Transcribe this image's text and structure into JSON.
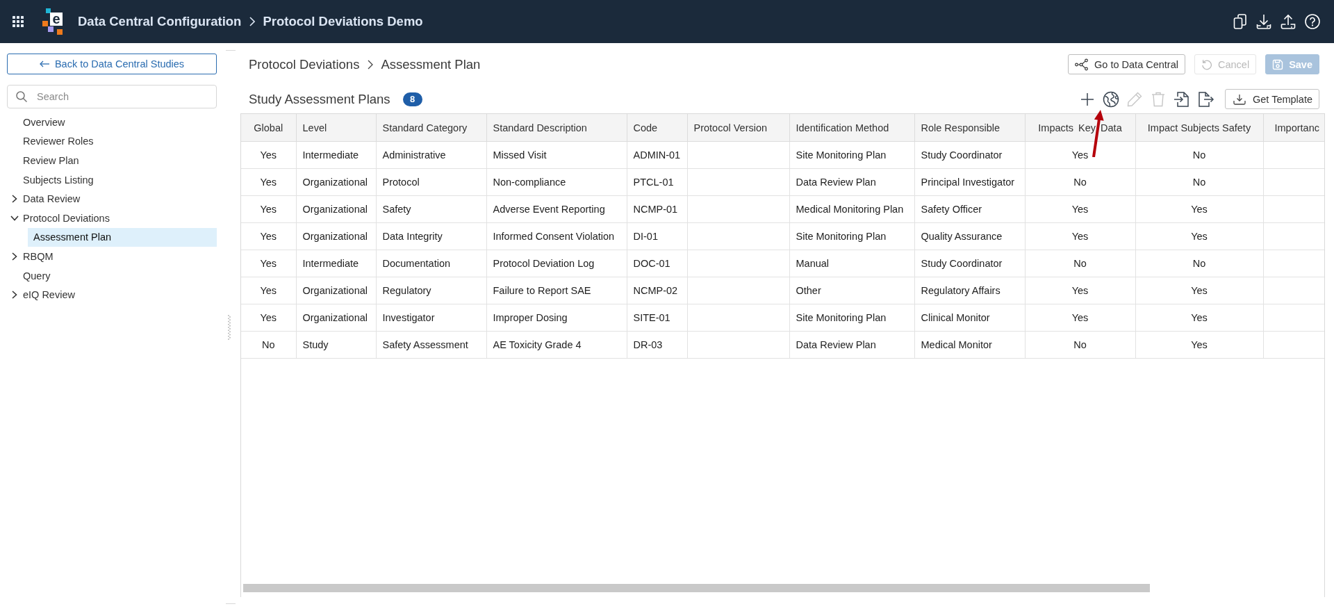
{
  "topbar": {
    "logo_letter": "e",
    "breadcrumb": [
      "Data Central Configuration",
      "Protocol Deviations Demo"
    ]
  },
  "sidebar": {
    "back_button": "Back to Data Central Studies",
    "search": {
      "placeholder": "Search"
    },
    "items": [
      {
        "label": "Overview",
        "kind": "page",
        "selected": false
      },
      {
        "label": "Reviewer Roles",
        "kind": "page",
        "selected": false
      },
      {
        "label": "Review Plan",
        "kind": "page",
        "selected": false
      },
      {
        "label": "Subjects Listing",
        "kind": "page",
        "selected": false
      },
      {
        "label": "Data Review",
        "kind": "folder",
        "expanded": false,
        "selected": false
      },
      {
        "label": "Protocol Deviations",
        "kind": "folder",
        "expanded": true,
        "selected": false,
        "children": [
          {
            "label": "Assessment Plan",
            "kind": "page",
            "selected": true
          }
        ]
      },
      {
        "label": "RBQM",
        "kind": "folder",
        "expanded": false,
        "selected": false
      },
      {
        "label": "Query",
        "kind": "page",
        "selected": false
      },
      {
        "label": "eIQ Review",
        "kind": "folder",
        "expanded": false,
        "selected": false
      }
    ]
  },
  "page": {
    "breadcrumb": [
      "Protocol Deviations",
      "Assessment Plan"
    ],
    "actions": [
      {
        "label": "Go to Data Central",
        "kind": "outline",
        "disabled": false
      },
      {
        "label": "Cancel",
        "kind": "outline",
        "disabled": true
      },
      {
        "label": "Save",
        "kind": "primary",
        "disabled": true
      }
    ]
  },
  "section": {
    "title": "Study Assessment Plans",
    "count": "8",
    "tools": [
      {
        "disabled": false
      },
      {
        "disabled": false
      },
      {
        "disabled": true
      },
      {
        "disabled": true
      },
      {
        "disabled": false
      },
      {
        "disabled": false
      }
    ],
    "template_button": "Get Template"
  },
  "table": {
    "columns": [
      "Global",
      "Level",
      "Standard Category",
      "Standard Description",
      "Code",
      "Protocol Version",
      "Identification Method",
      "Role Responsible",
      "Impacts Key Data",
      "Impact Subjects Safety",
      "Importanc"
    ],
    "rows": [
      {
        "global": "Yes",
        "level": "Intermediate",
        "standard_category": "Administrative",
        "standard_description": "Missed Visit",
        "code": "ADMIN-01",
        "identification_method": "Site Monitoring Plan",
        "role_responsible": "Study Coordinator",
        "impacts_key_data": "Yes",
        "impact_subjects_safety": "No"
      },
      {
        "global": "Yes",
        "level": "Organizational",
        "standard_category": "Protocol",
        "standard_description": "Non-compliance",
        "code": "PTCL-01",
        "identification_method": "Data Review Plan",
        "role_responsible": "Principal Investigator",
        "impacts_key_data": "No",
        "impact_subjects_safety": "No"
      },
      {
        "global": "Yes",
        "level": "Organizational",
        "standard_category": "Safety",
        "standard_description": "Adverse Event Reporting",
        "code": "NCMP-01",
        "identification_method": "Medical Monitoring Plan",
        "role_responsible": "Safety Officer",
        "impacts_key_data": "Yes",
        "impact_subjects_safety": "Yes"
      },
      {
        "global": "Yes",
        "level": "Organizational",
        "standard_category": "Data Integrity",
        "standard_description": "Informed Consent Violation",
        "code": "DI-01",
        "identification_method": "Site Monitoring Plan",
        "role_responsible": "Quality Assurance",
        "impacts_key_data": "Yes",
        "impact_subjects_safety": "Yes"
      },
      {
        "global": "Yes",
        "level": "Intermediate",
        "standard_category": "Documentation",
        "standard_description": "Protocol Deviation Log",
        "code": "DOC-01",
        "identification_method": "Manual",
        "role_responsible": "Study Coordinator",
        "impacts_key_data": "No",
        "impact_subjects_safety": "No"
      },
      {
        "global": "Yes",
        "level": "Organizational",
        "standard_category": "Regulatory",
        "standard_description": "Failure to Report SAE",
        "code": "NCMP-02",
        "identification_method": "Other",
        "role_responsible": "Regulatory Affairs",
        "impacts_key_data": "Yes",
        "impact_subjects_safety": "Yes"
      },
      {
        "global": "Yes",
        "level": "Organizational",
        "standard_category": "Investigator",
        "standard_description": "Improper Dosing",
        "code": "SITE-01",
        "identification_method": "Site Monitoring Plan",
        "role_responsible": "Clinical Monitor",
        "impacts_key_data": "Yes",
        "impact_subjects_safety": "Yes"
      },
      {
        "global": "No",
        "level": "Study",
        "standard_category": "Safety Assessment",
        "standard_description": "AE Toxicity Grade 4",
        "code": "DR-03",
        "identification_method": "Data Review Plan",
        "role_responsible": "Medical Monitor",
        "impacts_key_data": "No",
        "impact_subjects_safety": "Yes"
      }
    ]
  },
  "annotation": {
    "kind": "arrow"
  }
}
